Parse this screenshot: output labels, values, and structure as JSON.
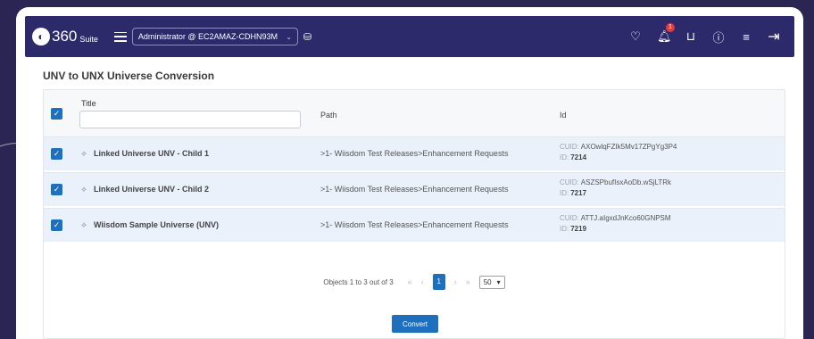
{
  "header": {
    "logo_mark": "360",
    "logo_text": "360",
    "logo_suite": "Suite",
    "environment": "Administrator @ EC2AMAZ-CDHN93M",
    "notifications_count": "1"
  },
  "page": {
    "title": "UNV to UNX Universe Conversion"
  },
  "table": {
    "columns": {
      "title": "Title",
      "path": "Path",
      "id": "Id"
    },
    "title_filter_placeholder": "",
    "cuid_label": "CUID:",
    "id_label": "ID:",
    "rows": [
      {
        "name": "Linked Universe UNV - Child 1",
        "path": ">1- Wiisdom Test Releases>Enhancement Requests",
        "cuid": "AXOwlqFZIk5Mv17ZPgYg3P4",
        "id": "7214",
        "checked": true
      },
      {
        "name": "Linked Universe UNV - Child 2",
        "path": ">1- Wiisdom Test Releases>Enhancement Requests",
        "cuid": "ASZSPbufIsxAoDb.wSjLTRk",
        "id": "7217",
        "checked": true
      },
      {
        "name": "Wiisdom Sample Universe (UNV)",
        "path": ">1- Wiisdom Test Releases>Enhancement Requests",
        "cuid": "ATTJ.aIgxdJnKco60GNPSM",
        "id": "7219",
        "checked": true
      }
    ]
  },
  "pagination": {
    "info": "Objects 1 to 3 out of 3",
    "first": "«",
    "prev": "‹",
    "current_page": "1",
    "next": "›",
    "last": "»",
    "page_size": "50"
  },
  "actions": {
    "convert_label": "Convert"
  },
  "colors": {
    "topbar": "#2c2a6b",
    "accent": "#1f6fbf",
    "row_selected": "#eaf1fb",
    "background": "#2a2552"
  }
}
